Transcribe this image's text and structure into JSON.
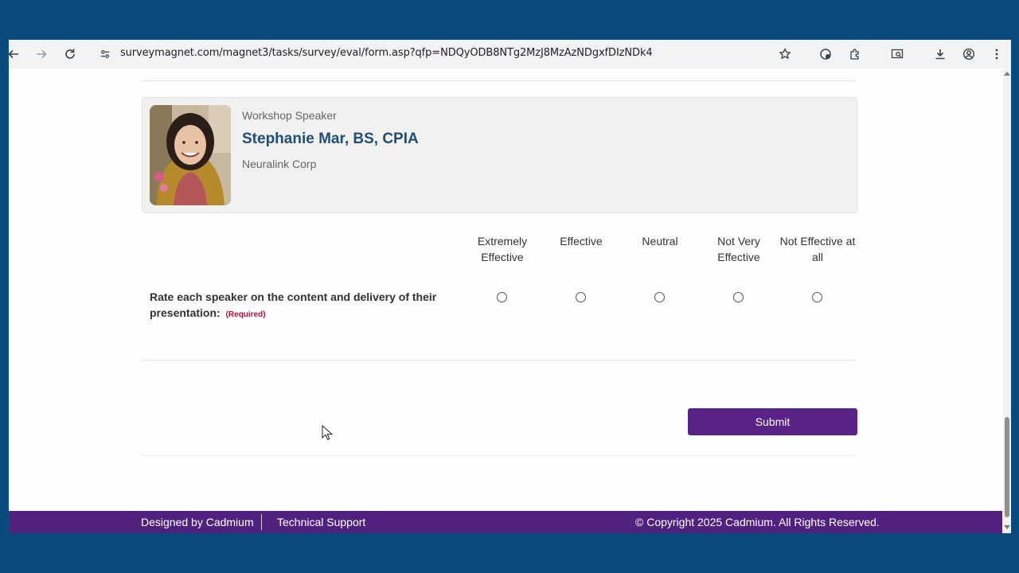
{
  "browser": {
    "url": "surveymagnet.com/magnet3/tasks/survey/eval/form.asp?qfp=NDQyODB8NTg2MzJ8MzAzNDgxfDIzNDk4"
  },
  "speaker": {
    "role": "Workshop Speaker",
    "name": "Stephanie Mar, BS, CPIA",
    "organization": "Neuralink Corp"
  },
  "rating": {
    "columns": [
      "Extremely Effective",
      "Effective",
      "Neutral",
      "Not Very Effective",
      "Not Effective at all"
    ],
    "question": "Rate each speaker on the content and delivery of their presentation:",
    "required_label": "(Required)"
  },
  "form": {
    "submit_label": "Submit"
  },
  "footer": {
    "designed_by": "Designed by Cadmium",
    "support": "Technical Support",
    "copyright": "© Copyright 2025 Cadmium. All Rights Reserved."
  },
  "colors": {
    "background": "#0b4a7c",
    "accent_purple": "#5a2186",
    "speaker_name": "#1f4e79",
    "required": "#b0123c"
  }
}
